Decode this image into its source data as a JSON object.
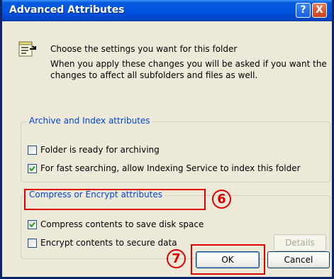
{
  "window": {
    "title": "Advanced Attributes"
  },
  "titlebar": {
    "help_glyph": "?",
    "close_glyph": "X"
  },
  "intro": {
    "line1": "Choose the settings you want for this folder",
    "line2": "When you apply these changes you will be asked if you want the changes to affect all subfolders and files as well."
  },
  "archive_group": {
    "title": "Archive and Index attributes",
    "items": [
      {
        "label": "Folder is ready for archiving",
        "checked": false
      },
      {
        "label": "For fast searching, allow Indexing Service to index this folder",
        "checked": true
      }
    ]
  },
  "compress_group": {
    "title": "Compress or Encrypt attributes",
    "items": [
      {
        "label": "Compress contents to save disk space",
        "checked": true
      },
      {
        "label": "Encrypt contents to secure data",
        "checked": false
      }
    ],
    "details_label": "Details"
  },
  "buttons": {
    "ok": "OK",
    "cancel": "Cancel"
  },
  "annotations": {
    "step6": "6",
    "step7": "7",
    "color": "#e00000"
  }
}
